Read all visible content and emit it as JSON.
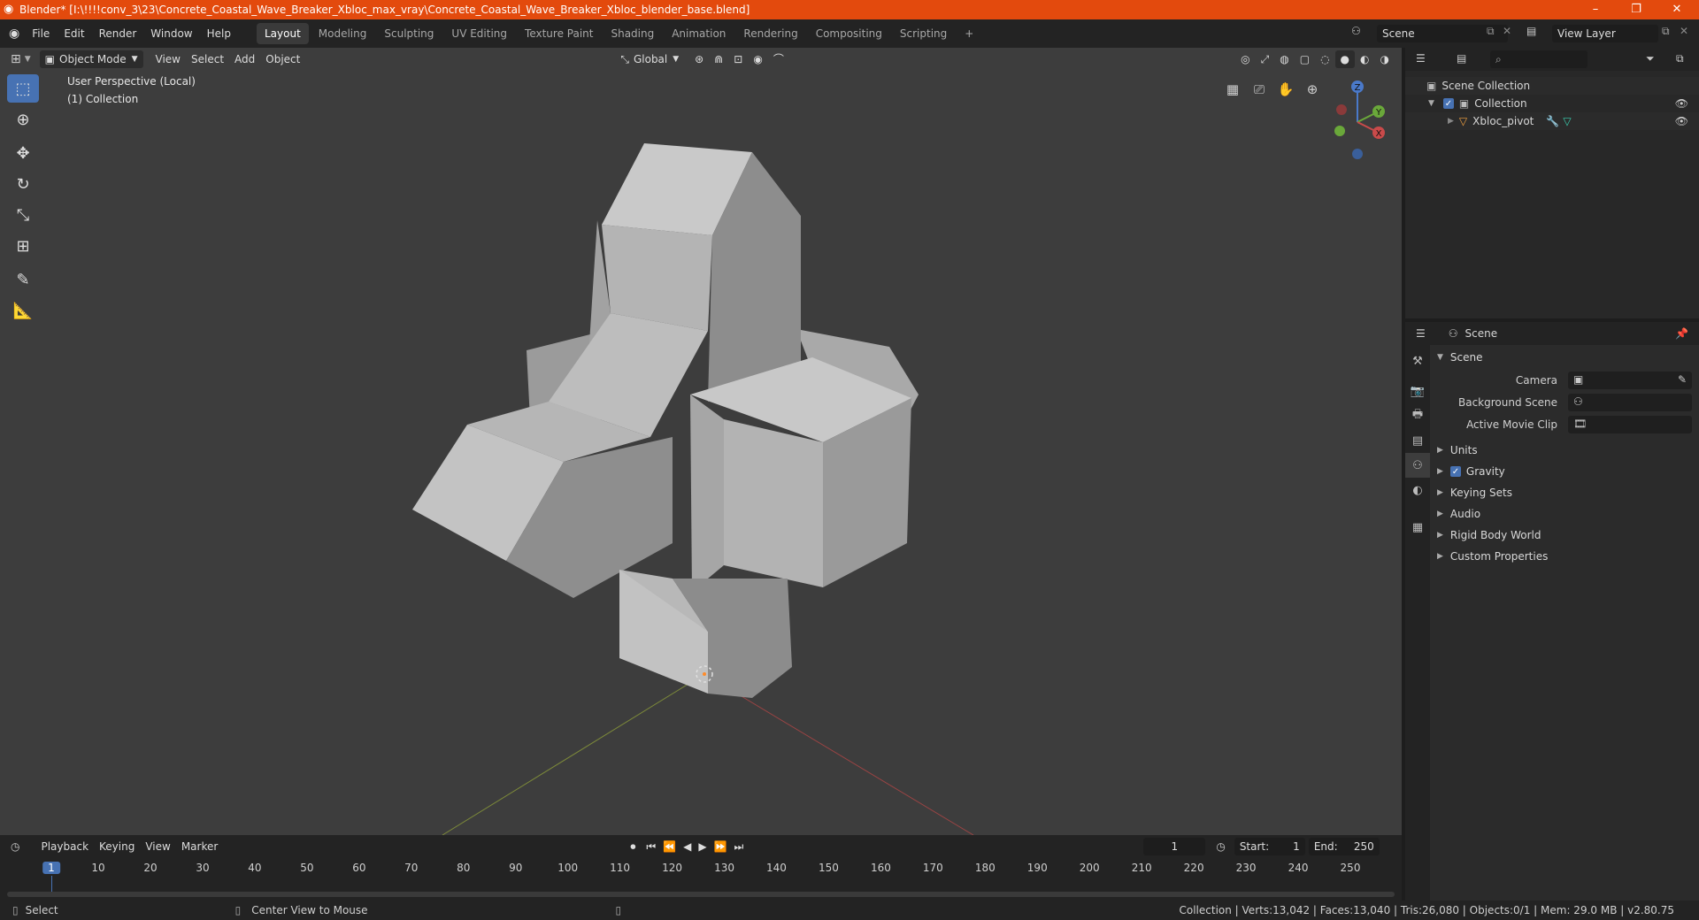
{
  "window": {
    "title": "Blender* [I:\\!!!!conv_3\\23\\Concrete_Coastal_Wave_Breaker_Xbloc_max_vray\\Concrete_Coastal_Wave_Breaker_Xbloc_blender_base.blend]",
    "controls": [
      "–",
      "❐",
      "✕"
    ]
  },
  "menu": [
    "File",
    "Edit",
    "Render",
    "Window",
    "Help"
  ],
  "workspaces": [
    "Layout",
    "Modeling",
    "Sculpting",
    "UV Editing",
    "Texture Paint",
    "Shading",
    "Animation",
    "Rendering",
    "Compositing",
    "Scripting"
  ],
  "active_workspace": "Layout",
  "scene_field": "Scene",
  "view_layer_field": "View Layer",
  "viewport": {
    "mode": "Object Mode",
    "menus": [
      "View",
      "Select",
      "Add",
      "Object"
    ],
    "transform_orientation": "Global",
    "perspective_label": "User Perspective (Local)",
    "collection_label": "(1) Collection",
    "gizmo": {
      "x": "X",
      "y": "Y",
      "z": "Z"
    }
  },
  "outliner": {
    "search_placeholder": "",
    "rows": [
      {
        "label": "Scene Collection"
      },
      {
        "label": "Collection"
      },
      {
        "label": "Xbloc_pivot"
      }
    ]
  },
  "properties": {
    "header": "Scene",
    "section": "Scene",
    "fields": [
      {
        "label": "Camera"
      },
      {
        "label": "Background Scene"
      },
      {
        "label": "Active Movie Clip"
      }
    ],
    "subsections": [
      "Units",
      "Gravity",
      "Keying Sets",
      "Audio",
      "Rigid Body World",
      "Custom Properties"
    ],
    "gravity_checked": true
  },
  "timeline": {
    "menus": [
      "Playback",
      "Keying",
      "View",
      "Marker"
    ],
    "current_frame": "1",
    "start_label": "Start:",
    "start": "1",
    "end_label": "End:",
    "end": "250",
    "ruler": [
      "1",
      "10",
      "20",
      "30",
      "40",
      "50",
      "60",
      "70",
      "80",
      "90",
      "100",
      "110",
      "120",
      "130",
      "140",
      "150",
      "160",
      "170",
      "180",
      "190",
      "200",
      "210",
      "220",
      "230",
      "240",
      "250"
    ]
  },
  "status": {
    "select": "Select",
    "center_view": "Center View to Mouse",
    "stats": "Collection | Verts:13,042 | Faces:13,040 | Tris:26,080 | Objects:0/1 | Mem: 29.0 MB | v2.80.75"
  },
  "colors": {
    "titlebar": "#e34a0d",
    "accent": "#4772b3",
    "viewport_bg": "#3d3d3d",
    "object_light": "#c4c4c4",
    "object_dark": "#8f8f8f"
  }
}
